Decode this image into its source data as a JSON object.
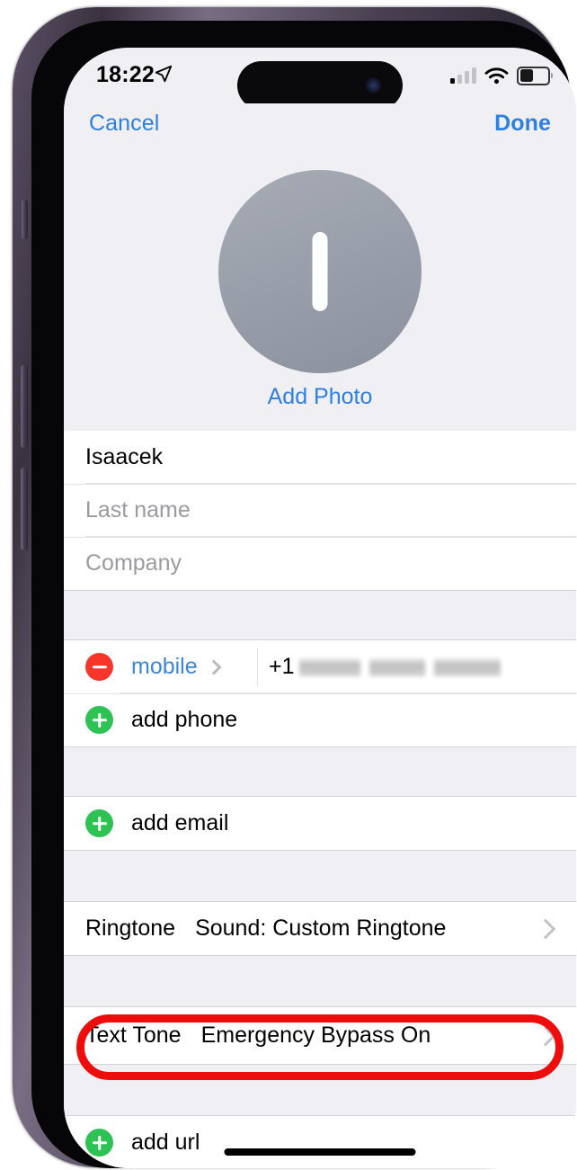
{
  "status_bar": {
    "time": "18:22",
    "location_icon": "location-arrow-icon",
    "cellular_icon": "cellular-signal-icon",
    "wifi_icon": "wifi-icon",
    "battery_icon": "battery-icon",
    "battery_level_percent": 55,
    "signal_bars_active": 1,
    "signal_bars_total": 4
  },
  "nav": {
    "cancel_label": "Cancel",
    "done_label": "Done"
  },
  "photo": {
    "monogram": "I",
    "add_photo_label": "Add Photo",
    "avatar_color": "#9aa0ab"
  },
  "name_fields": [
    {
      "name": "first-name",
      "value": "Isaacek",
      "placeholder": "First name",
      "filled": true
    },
    {
      "name": "last-name",
      "value": "Last name",
      "placeholder": "Last name",
      "filled": false
    },
    {
      "name": "company",
      "value": "Company",
      "placeholder": "Company",
      "filled": false
    }
  ],
  "phone_section": {
    "entry": {
      "remove_icon": "minus-circle-icon",
      "type_label": "mobile",
      "disclosure_icon": "chevron-right-icon",
      "country_code": "+1",
      "number_redacted": true
    },
    "add_row": {
      "add_icon": "plus-circle-icon",
      "label": "add phone"
    }
  },
  "email_section": {
    "add_row": {
      "add_icon": "plus-circle-icon",
      "label": "add email"
    }
  },
  "tone_rows": [
    {
      "name": "ringtone-row",
      "label": "Ringtone",
      "value": "Sound: Custom Ringtone",
      "disclosure_icon": "chevron-right-icon",
      "highlighted": false
    },
    {
      "name": "text-tone-row",
      "label": "Text Tone",
      "value": "Emergency Bypass On",
      "disclosure_icon": "chevron-right-icon",
      "highlighted": true
    }
  ],
  "url_section": {
    "add_row": {
      "add_icon": "plus-circle-icon",
      "label": "add url"
    }
  },
  "annotation": {
    "shape": "rounded-rectangle-outline",
    "color": "#ee0d0d",
    "target": "text-tone-row"
  },
  "colors": {
    "tint_blue": "#2f7fe0",
    "group_background": "#efeff4",
    "card_background": "#ffffff",
    "destructive_red": "#f8352a",
    "add_green": "#2ec254",
    "annotation_red": "#ee0d0d"
  }
}
